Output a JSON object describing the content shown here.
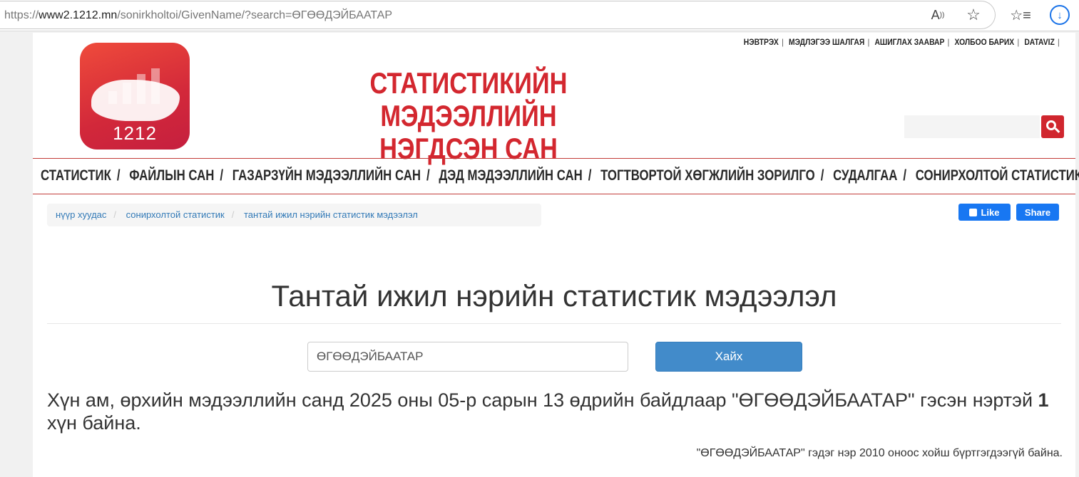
{
  "browser": {
    "url_prefix": "https://",
    "url_host": "www2.1212.mn",
    "url_path": "/sonirkholtoi/GivenName/?search=ӨГӨӨДЭЙБААТАР"
  },
  "header": {
    "logo_text": "1212",
    "title_line1": "СТАТИСТИКИЙН МЭДЭЭЛЛИЙН",
    "title_line2": "НЭГДСЭН САН",
    "top_links": [
      "НЭВТРЭХ",
      "МЭДЛЭГЭЭ ШАЛГАЯ",
      "АШИГЛАХ ЗААВАР",
      "ХОЛБОО БАРИХ",
      "DATAVIZ"
    ],
    "colors": {
      "brand_red": "#d3272f"
    }
  },
  "nav": {
    "items": [
      "СТАТИСТИК",
      "ФАЙЛЫН САН",
      "ГАЗАРЗҮЙН МЭДЭЭЛЛИЙН САН",
      "ДЭД МЭДЭЭЛЛИЙН САН",
      "ТОГТВОРТОЙ ХӨГЖЛИЙН ЗОРИЛГО",
      "СУДАЛГАА",
      "СОНИРХОЛТОЙ СТАТИСТИК"
    ]
  },
  "breadcrumb": {
    "items": [
      "нүүр хуудас",
      "сонирхолтой статистик",
      "тантай ижил нэрийн статистик мэдээлэл"
    ]
  },
  "social": {
    "like_label": "Like",
    "share_label": "Share"
  },
  "main": {
    "heading": "Тантай ижил нэрийн статистик мэдээлэл",
    "search_value": "ӨГӨӨДЭЙБААТАР",
    "search_button": "Хайх",
    "result_part1": "Хүн ам, өрхийн мэдээллийн санд 2025 оны 05-р сарын 13 өдрийн байдлаар \"ӨГӨӨДЭЙБААТАР\" гэсэн нэртэй ",
    "result_count": "1",
    "result_part2": " хүн байна.",
    "note": "\"ӨГӨӨДЭЙБААТАР\" гэдэг нэр 2010 оноос хойш бүртгэгдээгүй байна."
  }
}
